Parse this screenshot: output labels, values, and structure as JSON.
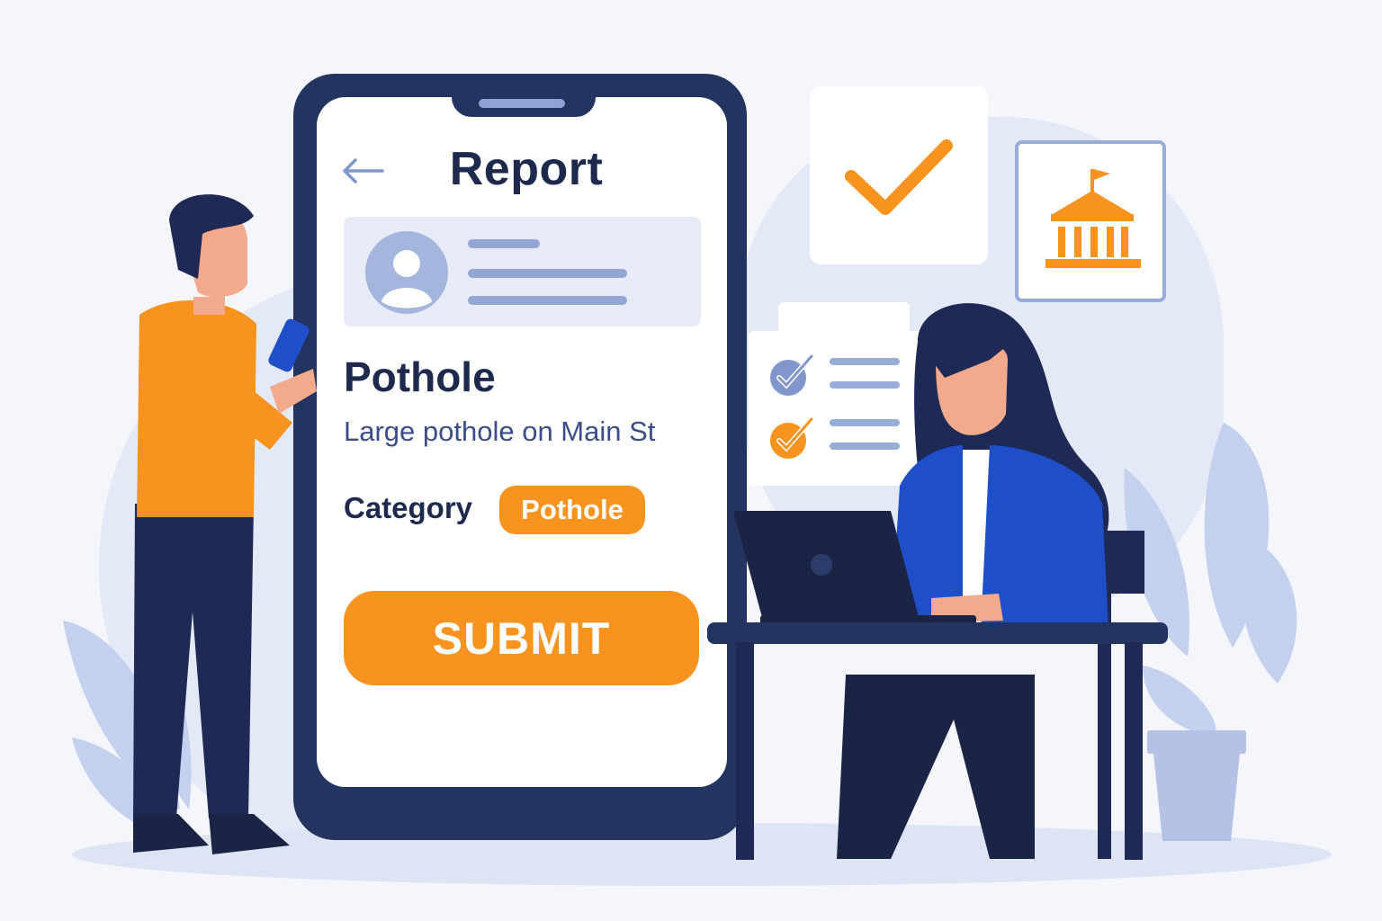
{
  "screen": {
    "title": "Report",
    "back_icon": "arrow-left-icon",
    "profile": {
      "avatar_icon": "user-avatar-icon"
    },
    "issue": {
      "title": "Pothole",
      "description": "Large pothole on Main St"
    },
    "category": {
      "label": "Category",
      "value": "Pothole"
    },
    "submit_label": "SUBMIT"
  },
  "illustration": {
    "check_icon": "checkmark-icon",
    "government_icon": "government-building-icon",
    "checklist_icons": [
      "checked-circle-icon",
      "checked-circle-icon"
    ]
  },
  "colors": {
    "accent": "#f7931e",
    "navy": "#22345f",
    "muted_blue": "#93a6d4",
    "background": "#f4f6fc"
  }
}
